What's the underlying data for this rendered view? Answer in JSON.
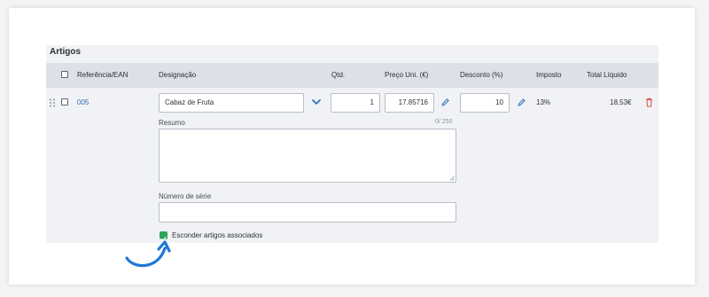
{
  "section": {
    "title": "Artigos"
  },
  "table": {
    "headers": {
      "ref": "Referência/EAN",
      "designation": "Designação",
      "qty": "Qtd.",
      "unit_price": "Preço Uni. (€)",
      "discount": "Desconto (%)",
      "tax": "Imposto",
      "total": "Total Líquido"
    },
    "row": {
      "ref": "005",
      "designation": "Cabaz de Fruta",
      "qty": "1",
      "unit_price": "17.85716",
      "discount": "10",
      "tax": "13%",
      "total": "18,53€"
    }
  },
  "summary": {
    "label": "Resumo",
    "counter": "0/ 250",
    "value": ""
  },
  "serial": {
    "label": "Número de série",
    "value": ""
  },
  "hide_associated": {
    "label": "Esconder artigos associados",
    "checked": true
  },
  "colors": {
    "accent": "#2f6fb8",
    "checkbox_checked": "#2ea25a",
    "delete": "#e04b4b",
    "header_bg": "#dde0e6"
  },
  "icons": [
    "drag-handle-icon",
    "chevron-down-icon",
    "pencil-icon",
    "trash-icon",
    "checkmark-icon",
    "curved-arrow-icon"
  ]
}
